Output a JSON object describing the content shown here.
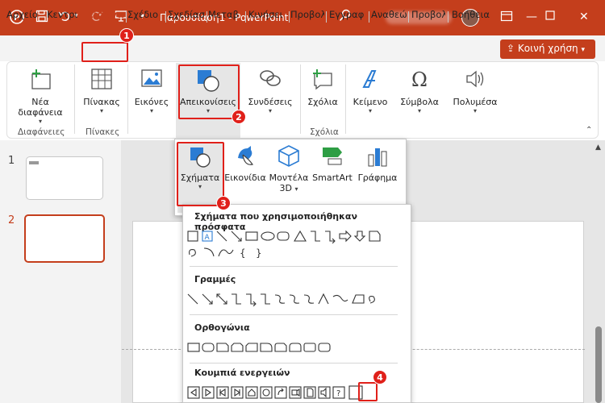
{
  "window": {
    "title": "Παρουσίαση1 - PowerPoint"
  },
  "tabs": [
    {
      "label": "Αρχείο"
    },
    {
      "label": "Κεντρι"
    },
    {
      "label": "Εισαγω"
    },
    {
      "label": "Σχέδιο"
    },
    {
      "label": "Σχεδίασ"
    },
    {
      "label": "Μεταβ"
    },
    {
      "label": "Κινήσει"
    },
    {
      "label": "Προβολ"
    },
    {
      "label": "Εγγραφ"
    },
    {
      "label": "Αναθεώ"
    },
    {
      "label": "Προβολ"
    },
    {
      "label": "Βοήθεια"
    }
  ],
  "share_button": {
    "label": "Κοινή χρήση"
  },
  "ribbon": {
    "new_slide": "Νέα διαφάνεια",
    "table": "Πίνακας",
    "images": "Εικόνες",
    "illustrations": "Απεικονίσεις",
    "links": "Συνδέσεις",
    "comments": "Σχόλια",
    "text": "Κείμενο",
    "symbols": "Σύμβολα",
    "media": "Πολυμέσα",
    "group_slides": "Διαφάνειες",
    "group_tables": "Πίνακες",
    "group_comments": "Σχόλια"
  },
  "illustrations_menu": {
    "shapes": "Σχήματα",
    "icons": "Εικονίδια",
    "models3d_line1": "Μοντέλα",
    "models3d_line2": "3D",
    "smartart": "SmartArt",
    "chart": "Γράφημα"
  },
  "shapes_panel": {
    "recent": "Σχήματα που χρησιμοποιήθηκαν πρόσφατα",
    "lines": "Γραμμές",
    "rectangles": "Ορθογώνια",
    "action_buttons": "Κουμπιά ενεργειών"
  },
  "slides": [
    {
      "number": "1"
    },
    {
      "number": "2"
    }
  ],
  "badges": [
    "1",
    "2",
    "3",
    "4"
  ],
  "colors": {
    "accent": "#c43e1c",
    "highlight": "#e0201a"
  }
}
